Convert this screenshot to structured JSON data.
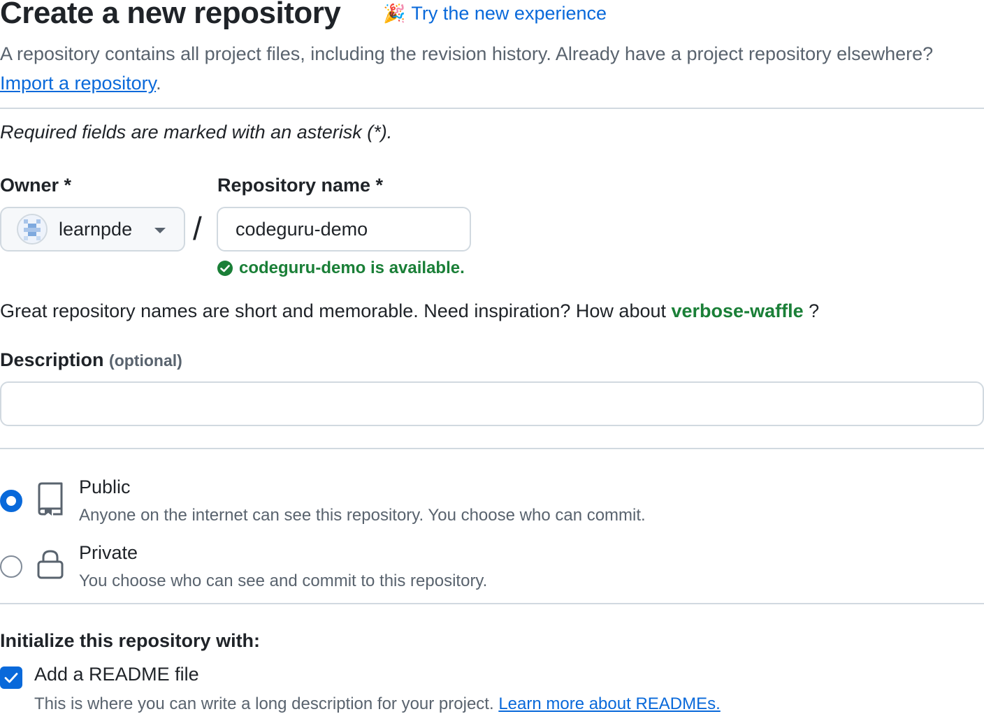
{
  "header": {
    "title": "Create a new repository",
    "try_link": "Try the new experience",
    "lead_text": "A repository contains all project files, including the revision history. Already have a project repository elsewhere?",
    "import_link": "Import a repository",
    "lead_end": "."
  },
  "form": {
    "required_note": "Required fields are marked with an asterisk (*).",
    "owner_label": "Owner *",
    "owner_value": "learnpde",
    "slash": "/",
    "repo_label": "Repository name *",
    "repo_value": "codeguru-demo",
    "availability": "codeguru-demo is available.",
    "inspiration_text": "Great repository names are short and memorable. Need inspiration? How about",
    "suggestion": "verbose-waffle",
    "inspiration_end": "?",
    "description_label": "Description",
    "description_optional": "(optional)",
    "description_value": ""
  },
  "visibility": {
    "selected": "public",
    "options": [
      {
        "title": "Public",
        "subtitle": "Anyone on the internet can see this repository. You choose who can commit.",
        "icon": "repo-icon"
      },
      {
        "title": "Private",
        "subtitle": "You choose who can see and commit to this repository.",
        "icon": "lock-icon"
      }
    ]
  },
  "initialize": {
    "label": "Initialize this repository with:",
    "readme_checked": true,
    "readme_title": "Add a README file",
    "readme_sub": "This is where you can write a long description for your project.",
    "readme_link": "Learn more about READMEs."
  },
  "colors": {
    "accent": "#0969da",
    "success": "#1a7f37",
    "muted": "#59636e",
    "border": "#d1d9e0"
  }
}
